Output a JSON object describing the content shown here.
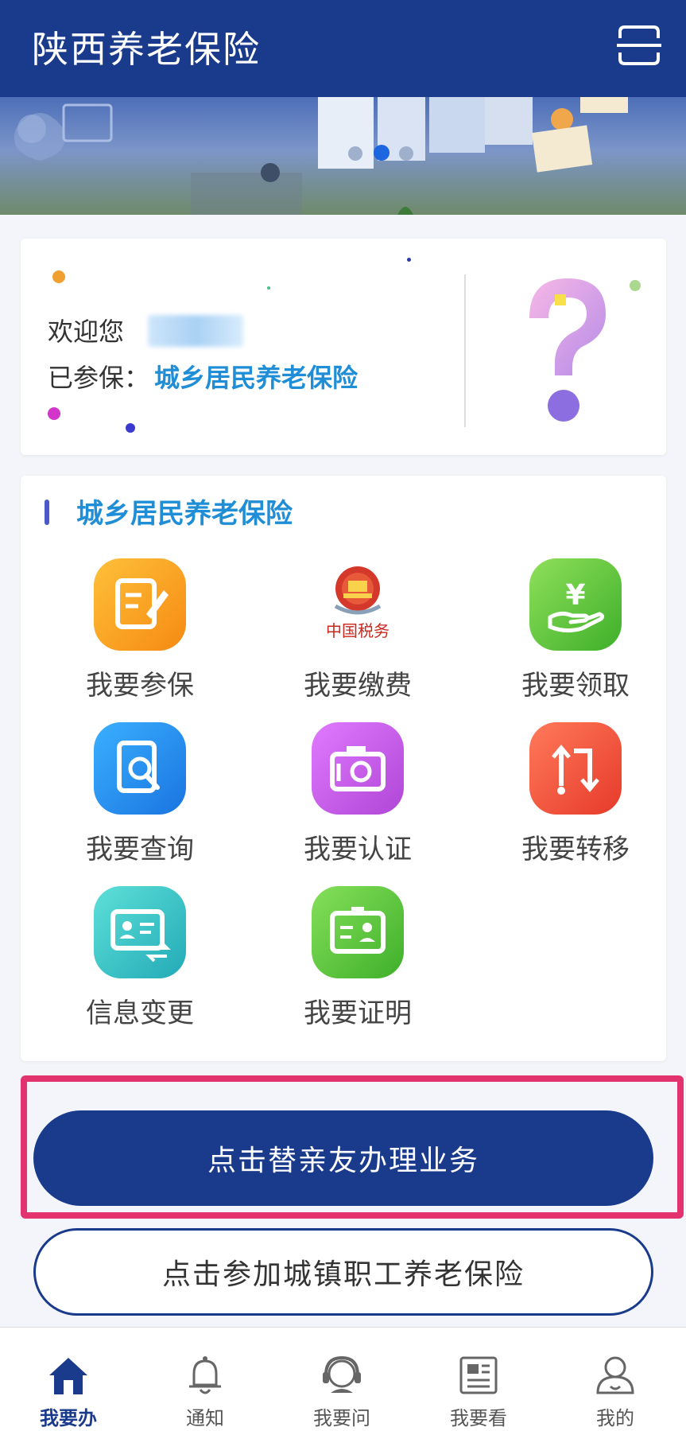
{
  "header": {
    "title": "陕西养老保险",
    "scan_icon": "scan-icon"
  },
  "banner": {
    "page_indicator": {
      "count": 3,
      "active_index": 1
    }
  },
  "welcome": {
    "greeting": "欢迎您",
    "insured_label": "已参保：",
    "insured_value": "城乡居民养老保险",
    "help_icon": "question-mark-icon"
  },
  "services": {
    "section_title": "城乡居民养老保险",
    "items": [
      {
        "label": "我要参保",
        "icon": "edit-document-icon",
        "color": "#f7a21b"
      },
      {
        "label": "我要缴费",
        "icon": "tax-emblem-icon",
        "color": "#c8281e"
      },
      {
        "label": "我要领取",
        "icon": "yen-hand-icon",
        "color": "#5cc63a"
      },
      {
        "label": "我要查询",
        "icon": "search-document-icon",
        "color": "#1e8ef0"
      },
      {
        "label": "我要认证",
        "icon": "camera-icon",
        "color": "#c655e6"
      },
      {
        "label": "我要转移",
        "icon": "transfer-icon",
        "color": "#f04f3a"
      },
      {
        "label": "信息变更",
        "icon": "id-card-change-icon",
        "color": "#2fc1c7"
      },
      {
        "label": "我要证明",
        "icon": "id-badge-icon",
        "color": "#55c43a"
      }
    ]
  },
  "actions": {
    "proxy_button": "点击替亲友办理业务",
    "join_urban_button": "点击参加城镇职工养老保险"
  },
  "bottom_nav": {
    "items": [
      {
        "label": "我要办",
        "icon": "home-icon",
        "active": true
      },
      {
        "label": "通知",
        "icon": "bell-icon",
        "active": false
      },
      {
        "label": "我要问",
        "icon": "customer-service-icon",
        "active": false
      },
      {
        "label": "我要看",
        "icon": "news-icon",
        "active": false
      },
      {
        "label": "我的",
        "icon": "user-icon",
        "active": false
      }
    ]
  },
  "colors": {
    "primary": "#1a3a8c",
    "accent_link": "#1f8ed6",
    "highlight_border": "#e2336f"
  }
}
